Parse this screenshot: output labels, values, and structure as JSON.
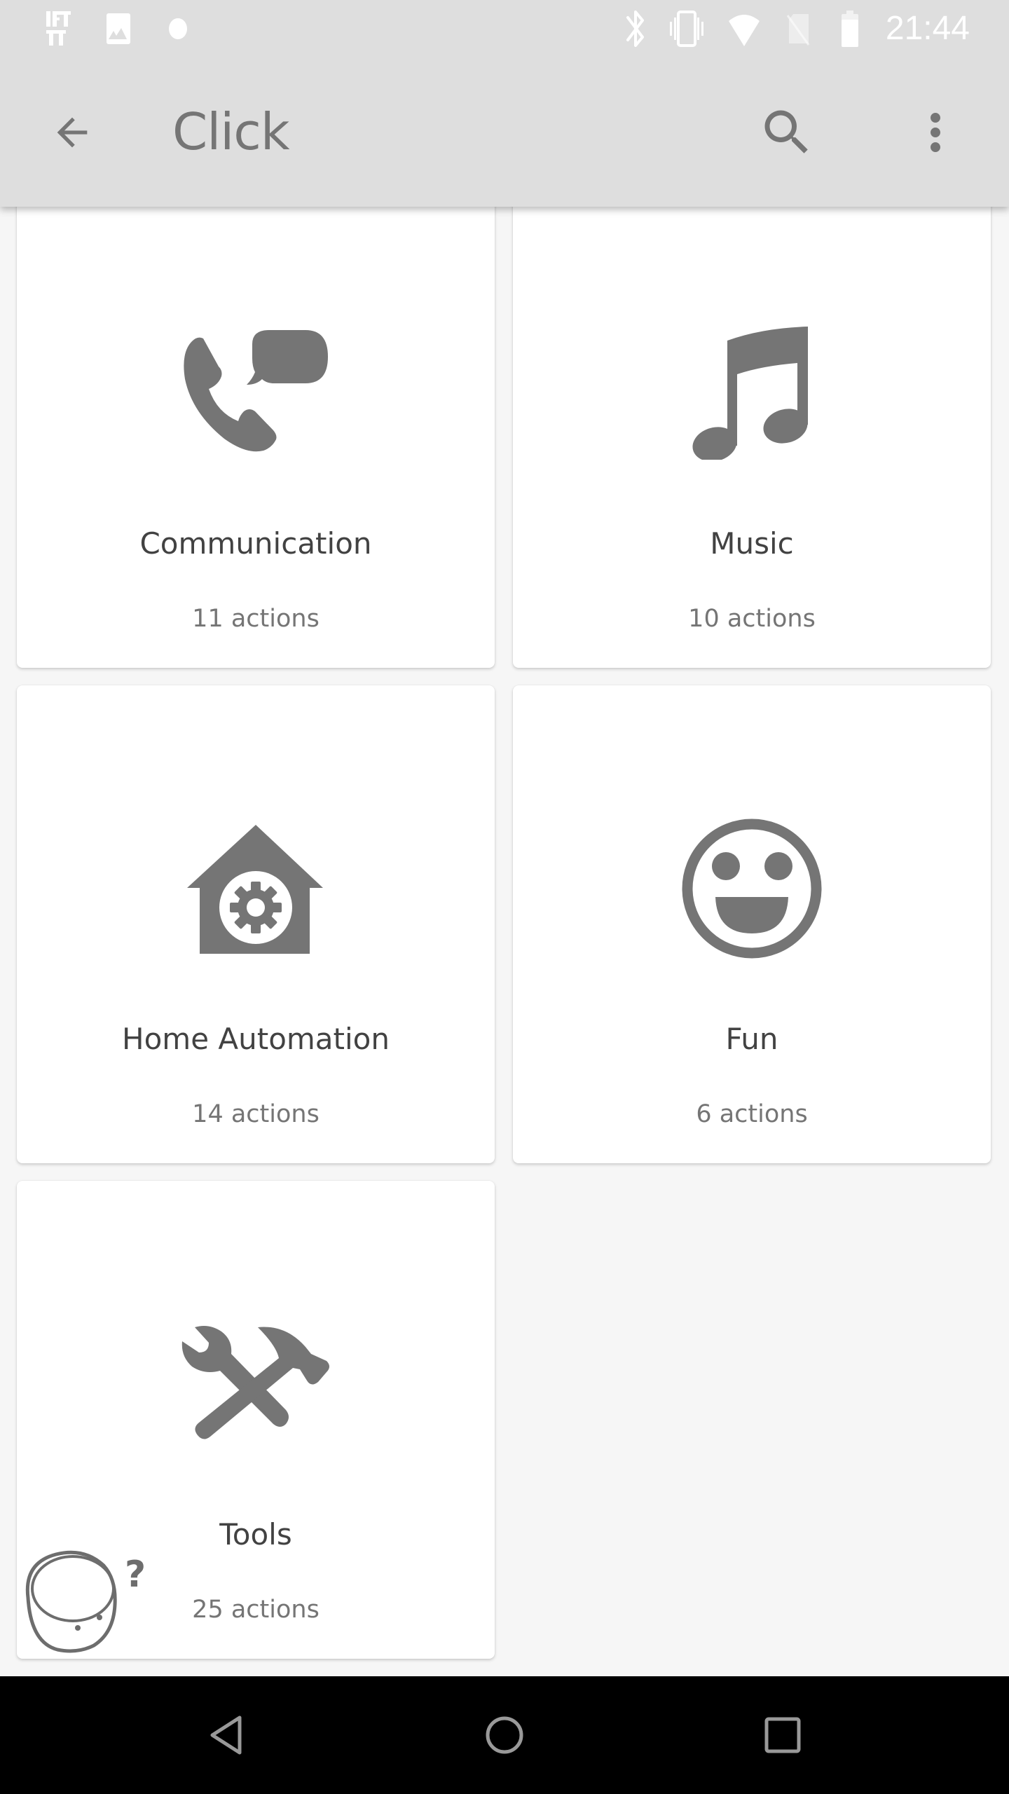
{
  "status_bar": {
    "time": "21:44",
    "left_icons": [
      "ifttt-icon",
      "image-notification-icon",
      "notification-dot-icon"
    ],
    "right_icons": [
      "bluetooth-icon",
      "vibrate-icon",
      "wifi-icon",
      "no-sim-icon",
      "battery-icon"
    ]
  },
  "app_bar": {
    "title": "Click",
    "back_icon": "arrow-back-icon",
    "search_icon": "search-icon",
    "more_icon": "more-vert-icon"
  },
  "categories": [
    {
      "title": "Communication",
      "subtitle": "11 actions",
      "icon": "phone-chat-icon"
    },
    {
      "title": "Music",
      "subtitle": "10 actions",
      "icon": "music-note-icon"
    },
    {
      "title": "Home Automation",
      "subtitle": "14 actions",
      "icon": "home-gear-icon"
    },
    {
      "title": "Fun",
      "subtitle": "6 actions",
      "icon": "smiley-icon"
    },
    {
      "title": "Tools",
      "subtitle": "25 actions",
      "icon": "wrench-hammer-icon"
    }
  ],
  "help_button": {
    "icon": "help-device-icon"
  },
  "nav_bar": {
    "back": "nav-back-icon",
    "home": "nav-home-icon",
    "recents": "nav-recents-icon"
  },
  "colors": {
    "bar_bg": "#dedede",
    "content_bg": "#f6f6f6",
    "icon_gray": "#757575",
    "title_text": "#424242"
  }
}
